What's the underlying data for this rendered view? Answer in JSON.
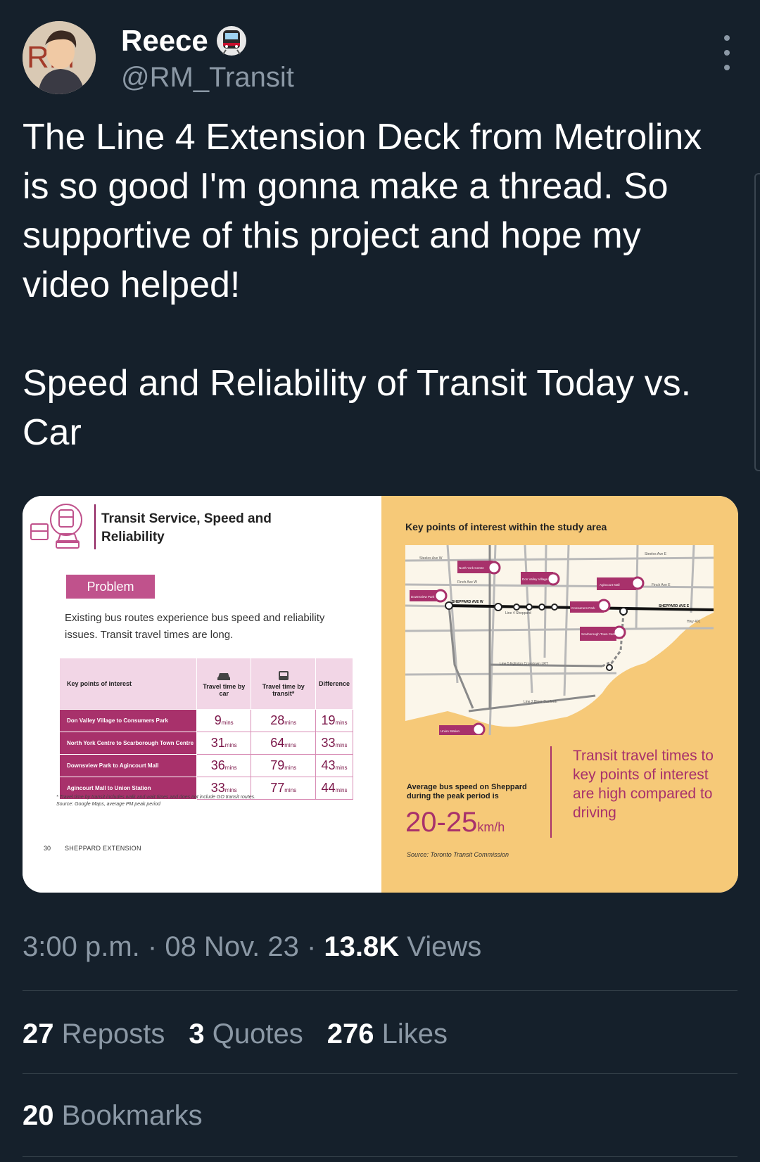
{
  "author": {
    "name": "Reece",
    "handle": "@RM_Transit",
    "avatar_initials": "RM",
    "badge_icon": "subway-train-icon"
  },
  "tweet": {
    "text": "The Line 4 Extension Deck from Metrolinx is so good I'm gonna make a thread. So supportive of this project and hope my video helped!\n\nSpeed and Reliability of Transit Today vs. Car"
  },
  "image": {
    "left": {
      "title": "Transit Service, Speed and Reliability",
      "problem_label": "Problem",
      "problem_text": "Existing bus routes experience bus speed and reliability issues. Transit travel times are long.",
      "table": {
        "headers": [
          "Key points of interest",
          "Travel time by car",
          "Travel time by transit*",
          "Difference"
        ],
        "unit": "mins",
        "rows": [
          {
            "route": "Don Valley Village to Consumers Park",
            "car": "9",
            "transit": "28",
            "diff": "19"
          },
          {
            "route": "North York Centre to Scarborough Town Centre",
            "car": "31",
            "transit": "64",
            "diff": "33"
          },
          {
            "route": "Downsview Park to Agincourt Mall",
            "car": "36",
            "transit": "79",
            "diff": "43"
          },
          {
            "route": "Agincourt Mall to Union Station",
            "car": "33",
            "transit": "77",
            "diff": "44"
          }
        ]
      },
      "footnote": "* Travel time by transit includes walk and wait times and does not include GO transit routes.",
      "source": "Source: Google Maps, average PM peak period",
      "page_number": "30",
      "page_title": "SHEPPARD EXTENSION"
    },
    "right": {
      "map_title": "Key points of interest within the study area",
      "map_labels": {
        "steeles_w": "Steeles Ave W",
        "steeles_e": "Steeles Ave E",
        "finch_w": "Finch Ave W",
        "finch_e": "Finch Ave E",
        "sheppard_w": "SHEPPARD AVE W",
        "sheppard_e": "SHEPPARD AVE E",
        "line4": "Line 4 Sheppard",
        "line5": "Line 5 Eglinton Crosstown LRT",
        "line2": "Line 2 Bloor-Danforth",
        "hwy401": "Hwy 401",
        "north_york": "North York Centre",
        "don_valley": "Don Valley Village",
        "agincourt": "Agincourt Mall",
        "downsview": "Downsview Park",
        "consumers": "Consumers Park",
        "scarborough": "Scarborough Town Centre",
        "union": "Union Station"
      },
      "speed_label": "Average bus speed on Sheppard during the peak period is",
      "speed_value": "20-25",
      "speed_unit": "km/h",
      "callout": "Transit travel times to key points of interest are high compared to driving",
      "source": "Source: Toronto Transit Commission"
    }
  },
  "meta": {
    "time": "3:00 p.m.",
    "date": "08 Nov. 23",
    "views_count": "13.8K",
    "views_label": "Views"
  },
  "stats": {
    "reposts_count": "27",
    "reposts_label": "Reposts",
    "quotes_count": "3",
    "quotes_label": "Quotes",
    "likes_count": "276",
    "likes_label": "Likes",
    "bookmarks_count": "20",
    "bookmarks_label": "Bookmarks"
  },
  "colors": {
    "background": "#15202b",
    "text": "#ffffff",
    "secondary": "#8b98a5",
    "accent_magenta": "#a8316b",
    "map_bg": "#f6c978"
  }
}
